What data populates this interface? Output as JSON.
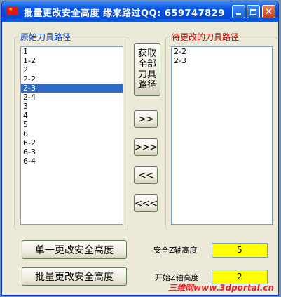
{
  "window": {
    "title": "批量更改安全高度    缘来路过QQ: 659747829"
  },
  "left_group": {
    "label": "原始刀具路径",
    "items": [
      "1",
      "1-2",
      "2",
      "2-2",
      "2-3",
      "2-4",
      "3",
      "4",
      "5",
      "6",
      "6-2",
      "6-3",
      "6-4"
    ],
    "selected": "2-3"
  },
  "right_group": {
    "label": "待更改的刀具路径",
    "items": [
      "2-2",
      "2-3"
    ]
  },
  "buttons": {
    "fetch_all": "获取全部刀具路径",
    "move_right": ">>",
    "move_all_right": ">>>",
    "move_left": "<<",
    "move_all_left": "<<<",
    "single_change": "单一更改安全高度",
    "batch_change": "批量更改安全高度"
  },
  "fields": {
    "safe_z_label": "安全Z轴高度",
    "safe_z_value": "5",
    "start_z_label": "开始Z轴高度",
    "start_z_value": "2"
  },
  "watermark": "三维网www.3dportal.cn",
  "colors": {
    "title_bar": "#0a55e0",
    "selection": "#316ac5",
    "value_field": "#ffff00",
    "left_group_label": "#0046d5",
    "right_group_label": "#d20000"
  }
}
